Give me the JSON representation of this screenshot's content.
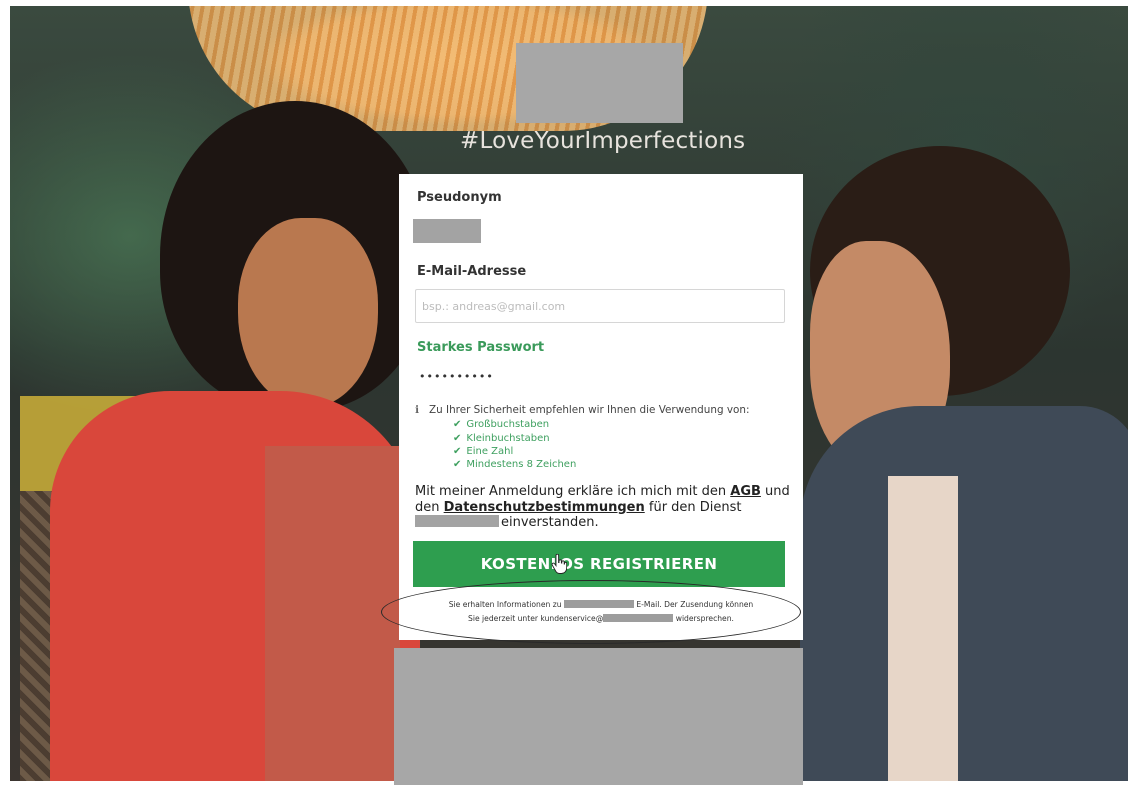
{
  "brand": {
    "hashtag": "#LoveYourImperfections"
  },
  "form": {
    "pseudonym_label": "Pseudonym",
    "email_label": "E-Mail-Adresse",
    "email_placeholder": "bsp.: andreas@gmail.com",
    "password_strength": "Starkes Passwort",
    "password_value": "••••••••••",
    "security_hint": "Zu Ihrer Sicherheit empfehlen wir Ihnen die Verwendung von:",
    "requirements": [
      "Großbuchstaben",
      "Kleinbuchstaben",
      "Eine Zahl",
      "Mindestens 8 Zeichen"
    ],
    "terms": {
      "prefix": "Mit meiner Anmeldung erkläre ich mich mit den",
      "agb_link": "AGB",
      "middle": "und den",
      "privacy_link": "Datenschutzbestimmungen",
      "service": "für den Dienst",
      "suffix": "einverstanden."
    },
    "register_button": "KOSTENLOS REGISTRIEREN",
    "fineprint": {
      "line1_prefix": "Sie erhalten Informationen zu",
      "line1_suffix": "E-Mail. Der Zusendung können",
      "line2_prefix": "Sie jederzeit unter kundenservice@",
      "line2_suffix": "widersprechen."
    }
  },
  "colors": {
    "accent_green": "#2e9e4f",
    "strength_green": "#3a9a5a",
    "redaction_gray": "#a7a7a7"
  },
  "icons": [
    "info-icon",
    "checkmark-icon",
    "hand-pointer-icon"
  ]
}
